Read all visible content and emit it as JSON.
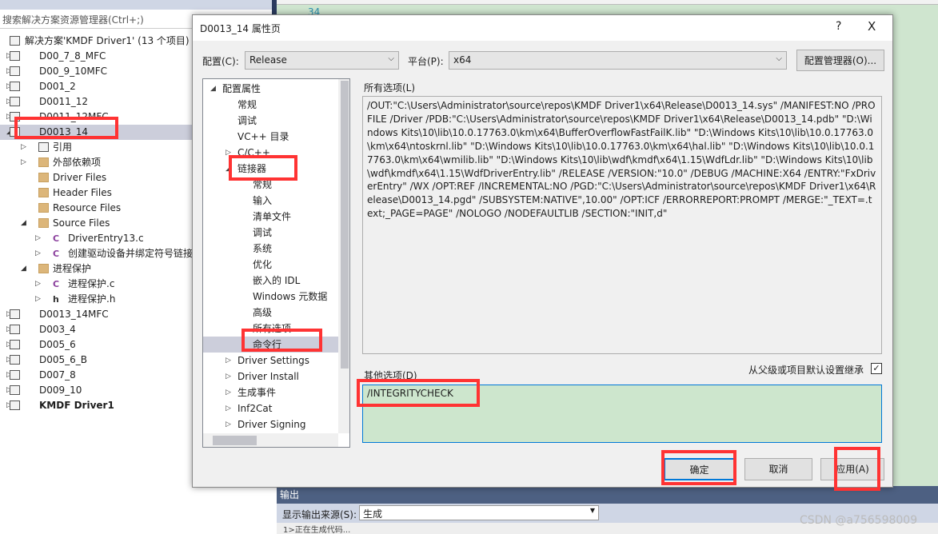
{
  "solution_explorer": {
    "search_placeholder": "搜索解决方案资源管理器(Ctrl+;)",
    "items": [
      {
        "label": "解决方案'KMDF Driver1' (13 个项目)",
        "level": 0,
        "icon": "solution-icon",
        "arrow": ""
      },
      {
        "label": "D00_7_8_MFC",
        "level": 0,
        "icon": "project-icon",
        "arrow": "collapsed"
      },
      {
        "label": "D00_9_10MFC",
        "level": 0,
        "icon": "project-icon",
        "arrow": "collapsed"
      },
      {
        "label": "D001_2",
        "level": 0,
        "icon": "project-icon",
        "arrow": "collapsed"
      },
      {
        "label": "D0011_12",
        "level": 0,
        "icon": "project-icon",
        "arrow": "collapsed"
      },
      {
        "label": "D0011_12MFC",
        "level": 0,
        "icon": "project-icon",
        "arrow": "collapsed"
      },
      {
        "label": "D0013_14",
        "level": 0,
        "icon": "project-icon",
        "arrow": "expanded",
        "selected": true
      },
      {
        "label": "引用",
        "level": 1,
        "icon": "references-icon",
        "arrow": "collapsed"
      },
      {
        "label": "外部依赖项",
        "level": 1,
        "icon": "folder-icon",
        "arrow": "collapsed"
      },
      {
        "label": "Driver Files",
        "level": 1,
        "icon": "folder-icon",
        "arrow": ""
      },
      {
        "label": "Header Files",
        "level": 1,
        "icon": "folder-icon",
        "arrow": ""
      },
      {
        "label": "Resource Files",
        "level": 1,
        "icon": "folder-icon",
        "arrow": ""
      },
      {
        "label": "Source Files",
        "level": 1,
        "icon": "folder-icon",
        "arrow": "expanded"
      },
      {
        "label": "DriverEntry13.c",
        "level": 2,
        "icon": "c-file-icon",
        "arrow": "collapsed"
      },
      {
        "label": "创建驱动设备并绑定符号链接",
        "level": 2,
        "icon": "c-file-icon",
        "arrow": "collapsed"
      },
      {
        "label": "进程保护",
        "level": 1,
        "icon": "folder-icon",
        "arrow": "expanded"
      },
      {
        "label": "进程保护.c",
        "level": 2,
        "icon": "c-file-icon",
        "arrow": "collapsed"
      },
      {
        "label": "进程保护.h",
        "level": 2,
        "icon": "h-file-icon",
        "arrow": "collapsed"
      },
      {
        "label": "D0013_14MFC",
        "level": 0,
        "icon": "project-icon",
        "arrow": "collapsed"
      },
      {
        "label": "D003_4",
        "level": 0,
        "icon": "project-icon",
        "arrow": "collapsed"
      },
      {
        "label": "D005_6",
        "level": 0,
        "icon": "project-icon",
        "arrow": "collapsed"
      },
      {
        "label": "D005_6_B",
        "level": 0,
        "icon": "project-icon",
        "arrow": "collapsed"
      },
      {
        "label": "D007_8",
        "level": 0,
        "icon": "project-icon",
        "arrow": "collapsed"
      },
      {
        "label": "D009_10",
        "level": 0,
        "icon": "project-icon",
        "arrow": "collapsed"
      },
      {
        "label": "KMDF Driver1",
        "level": 0,
        "icon": "project-icon",
        "arrow": "collapsed",
        "bold": true
      }
    ]
  },
  "editor": {
    "line_number": "34"
  },
  "output": {
    "title": "输出",
    "source_label": "显示输出来源(S):",
    "source_value": "生成",
    "text": "1>正在生成代码..."
  },
  "watermark": "CSDN @a756598009",
  "dialog": {
    "title": "D0013_14 属性页",
    "help": "?",
    "close": "X",
    "config_label": "配置(C):",
    "config_value": "Release",
    "platform_label": "平台(P):",
    "platform_value": "x64",
    "config_manager": "配置管理器(O)...",
    "tree": [
      {
        "label": "配置属性",
        "level": 0,
        "arrow": "expanded"
      },
      {
        "label": "常规",
        "level": 1
      },
      {
        "label": "调试",
        "level": 1
      },
      {
        "label": "VC++ 目录",
        "level": 1
      },
      {
        "label": "C/C++",
        "level": 1,
        "arrow": "collapsed"
      },
      {
        "label": "链接器",
        "level": 1,
        "arrow": "expanded"
      },
      {
        "label": "常规",
        "level": 2
      },
      {
        "label": "输入",
        "level": 2
      },
      {
        "label": "清单文件",
        "level": 2
      },
      {
        "label": "调试",
        "level": 2
      },
      {
        "label": "系统",
        "level": 2
      },
      {
        "label": "优化",
        "level": 2
      },
      {
        "label": "嵌入的 IDL",
        "level": 2
      },
      {
        "label": "Windows 元数据",
        "level": 2
      },
      {
        "label": "高级",
        "level": 2
      },
      {
        "label": "所有选项",
        "level": 2
      },
      {
        "label": "命令行",
        "level": 2,
        "selected": true
      },
      {
        "label": "Driver Settings",
        "level": 1,
        "arrow": "collapsed"
      },
      {
        "label": "Driver Install",
        "level": 1,
        "arrow": "collapsed"
      },
      {
        "label": "生成事件",
        "level": 1,
        "arrow": "collapsed"
      },
      {
        "label": "Inf2Cat",
        "level": 1,
        "arrow": "collapsed"
      },
      {
        "label": "Driver Signing",
        "level": 1,
        "arrow": "collapsed"
      }
    ],
    "all_options_label": "所有选项(L)",
    "all_options": "/OUT:\"C:\\Users\\Administrator\\source\\repos\\KMDF Driver1\\x64\\Release\\D0013_14.sys\" /MANIFEST:NO /PROFILE /Driver /PDB:\"C:\\Users\\Administrator\\source\\repos\\KMDF Driver1\\x64\\Release\\D0013_14.pdb\" \"D:\\Windows Kits\\10\\lib\\10.0.17763.0\\km\\x64\\BufferOverflowFastFailK.lib\" \"D:\\Windows Kits\\10\\lib\\10.0.17763.0\\km\\x64\\ntoskrnl.lib\" \"D:\\Windows Kits\\10\\lib\\10.0.17763.0\\km\\x64\\hal.lib\" \"D:\\Windows Kits\\10\\lib\\10.0.17763.0\\km\\x64\\wmilib.lib\" \"D:\\Windows Kits\\10\\lib\\wdf\\kmdf\\x64\\1.15\\WdfLdr.lib\" \"D:\\Windows Kits\\10\\lib\\wdf\\kmdf\\x64\\1.15\\WdfDriverEntry.lib\" /RELEASE /VERSION:\"10.0\" /DEBUG /MACHINE:X64 /ENTRY:\"FxDriverEntry\" /WX /OPT:REF /INCREMENTAL:NO /PGD:\"C:\\Users\\Administrator\\source\\repos\\KMDF Driver1\\x64\\Release\\D0013_14.pgd\" /SUBSYSTEM:NATIVE\",10.00\" /OPT:ICF /ERRORREPORT:PROMPT /MERGE:\"_TEXT=.text;_PAGE=PAGE\" /NOLOGO /NODEFAULTLIB /SECTION:\"INIT,d\"",
    "inherit_label": "从父级或项目默认设置继承",
    "inherit_checked": true,
    "other_options_label": "其他选项(D)",
    "other_options": "/INTEGRITYCHECK",
    "ok": "确定",
    "cancel": "取消",
    "apply": "应用(A)"
  },
  "colors": {
    "highlight": "#ff3333",
    "selection": "#cccedb",
    "accent": "#0078d7",
    "editor_bg": "#cfe5cf"
  }
}
